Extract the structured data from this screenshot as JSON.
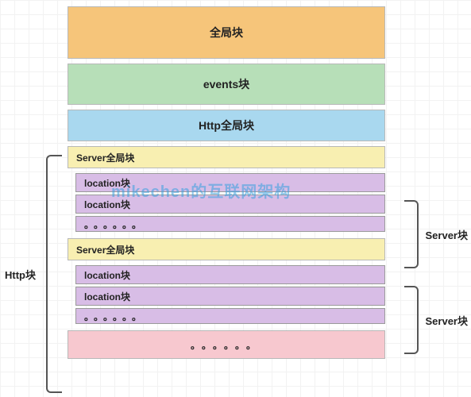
{
  "watermark": "mikechen的互联网架构",
  "blocks": {
    "global": "全局块",
    "events": "events块",
    "http_global": "Http全局块",
    "server1": {
      "global": "Server全局块",
      "loc1": "location块",
      "loc2": "location块",
      "dots": "。。。。。。"
    },
    "server2": {
      "global": "Server全局块",
      "loc1": "location块",
      "loc2": "location块",
      "dots": "。。。。。。"
    },
    "more": "。。。。。。"
  },
  "brackets": {
    "http": "Http块",
    "server1": "Server块",
    "server2": "Server块"
  }
}
